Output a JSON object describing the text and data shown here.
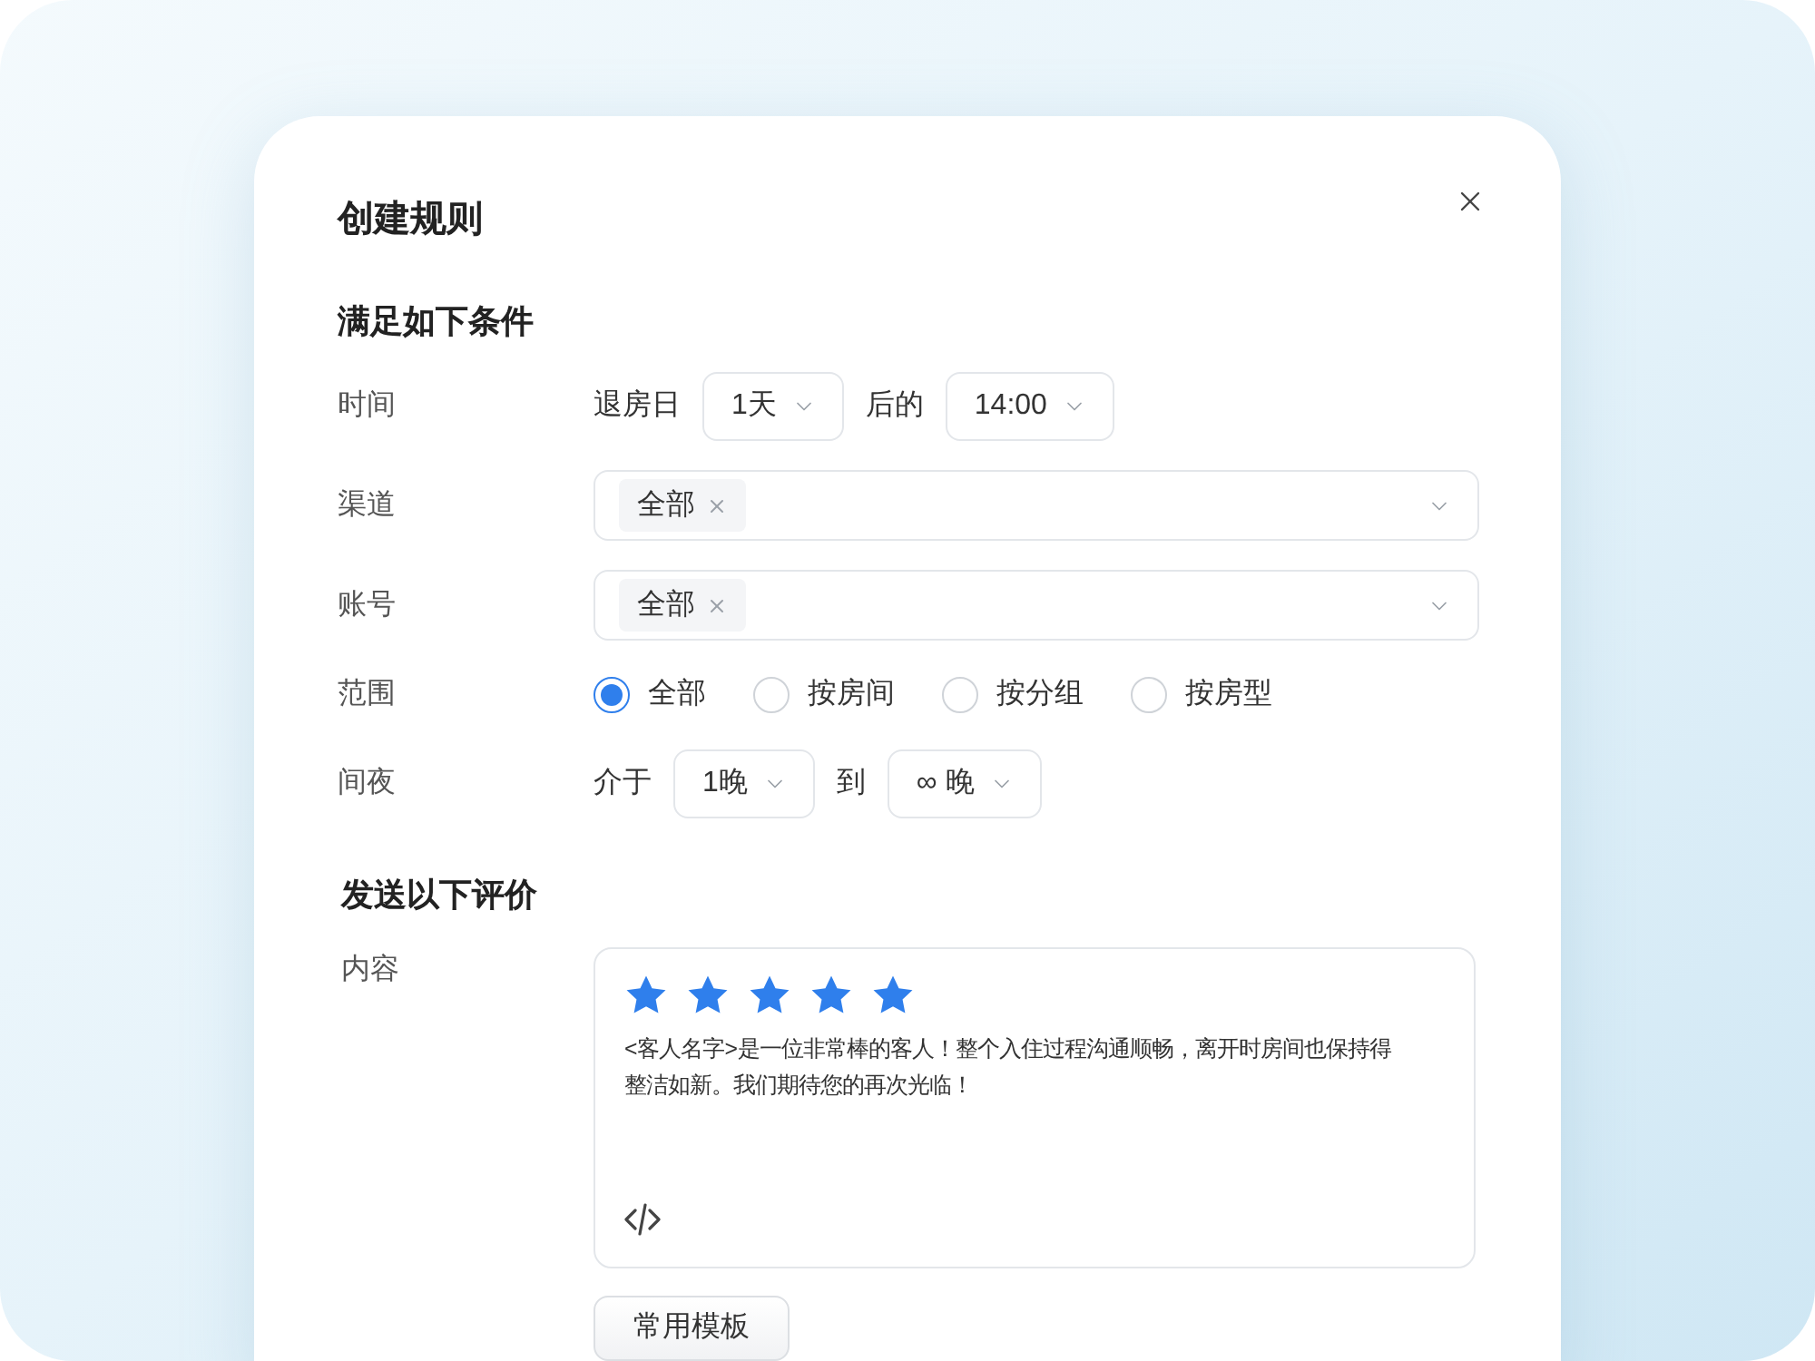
{
  "title": "创建规则",
  "conditions": {
    "heading": "满足如下条件",
    "rows": [
      {
        "kind": "inline",
        "label": "时间",
        "parts": [
          {
            "kind": "text",
            "text": "退房日"
          },
          {
            "kind": "select",
            "value": "1天"
          },
          {
            "kind": "text",
            "text": "后的"
          },
          {
            "kind": "select",
            "value": "14:00"
          }
        ]
      },
      {
        "kind": "multiselect",
        "label": "渠道",
        "tags": [
          "全部"
        ]
      },
      {
        "kind": "multiselect",
        "label": "账号",
        "tags": [
          "全部"
        ]
      },
      {
        "kind": "radio",
        "label": "范围",
        "options": [
          {
            "label": "全部",
            "selected": true
          },
          {
            "label": "按房间",
            "selected": false
          },
          {
            "label": "按分组",
            "selected": false
          },
          {
            "label": "按房型",
            "selected": false
          }
        ]
      },
      {
        "kind": "inline",
        "label": "间夜",
        "parts": [
          {
            "kind": "text",
            "text": "介于"
          },
          {
            "kind": "select",
            "value": "1晚"
          },
          {
            "kind": "text",
            "text": "到"
          },
          {
            "kind": "select",
            "value": "∞ 晚"
          }
        ]
      }
    ]
  },
  "review": {
    "heading": "发送以下评价",
    "label": "内容",
    "stars": 5,
    "text": "<客人名字>是一位非常棒的客人！整个入住过程沟通顺畅，离开时房间也保持得整洁如新。我们期待您的再次光临！",
    "template_button": "常用模板"
  }
}
